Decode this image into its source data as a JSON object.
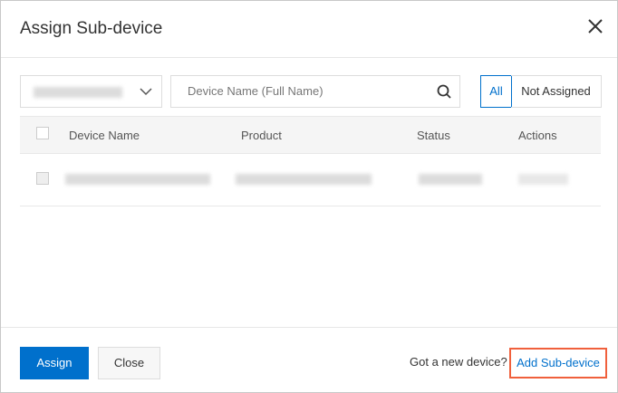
{
  "dialog": {
    "title": "Assign Sub-device"
  },
  "filters": {
    "search_placeholder": "Device Name (Full Name)",
    "toggle": [
      {
        "label": "All",
        "selected": true
      },
      {
        "label": "Not Assigned",
        "selected": false
      }
    ]
  },
  "table": {
    "columns": [
      "Device Name",
      "Product",
      "Status",
      "Actions"
    ]
  },
  "footer": {
    "assign_label": "Assign",
    "close_label": "Close",
    "prompt": "Got a new device?",
    "add_link": "Add Sub-device"
  },
  "colors": {
    "accent": "#0070cc",
    "highlight": "#f0603c"
  }
}
